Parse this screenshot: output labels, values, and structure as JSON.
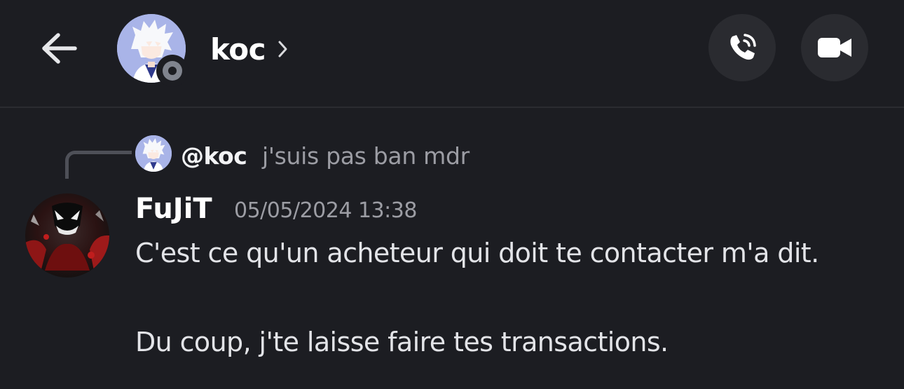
{
  "header": {
    "channel_name": "koc",
    "chevron": "›",
    "back_icon": "arrow-left-icon",
    "call_icon": "phone-call-icon",
    "video_icon": "video-camera-icon",
    "status": "offline"
  },
  "reply": {
    "author": "@koc",
    "text": "j'suis pas ban mdr"
  },
  "message": {
    "author": "FuJiT",
    "timestamp": "05/05/2024 13:38",
    "lines": [
      "C'est ce qu'un acheteur qui doit te contacter m'a dit.",
      "Du coup, j'te laisse faire tes transactions."
    ]
  },
  "colors": {
    "background": "#1c1d22",
    "button_bg": "#2a2b30",
    "muted_text": "#9c9da4",
    "status_offline": "#80848e"
  }
}
